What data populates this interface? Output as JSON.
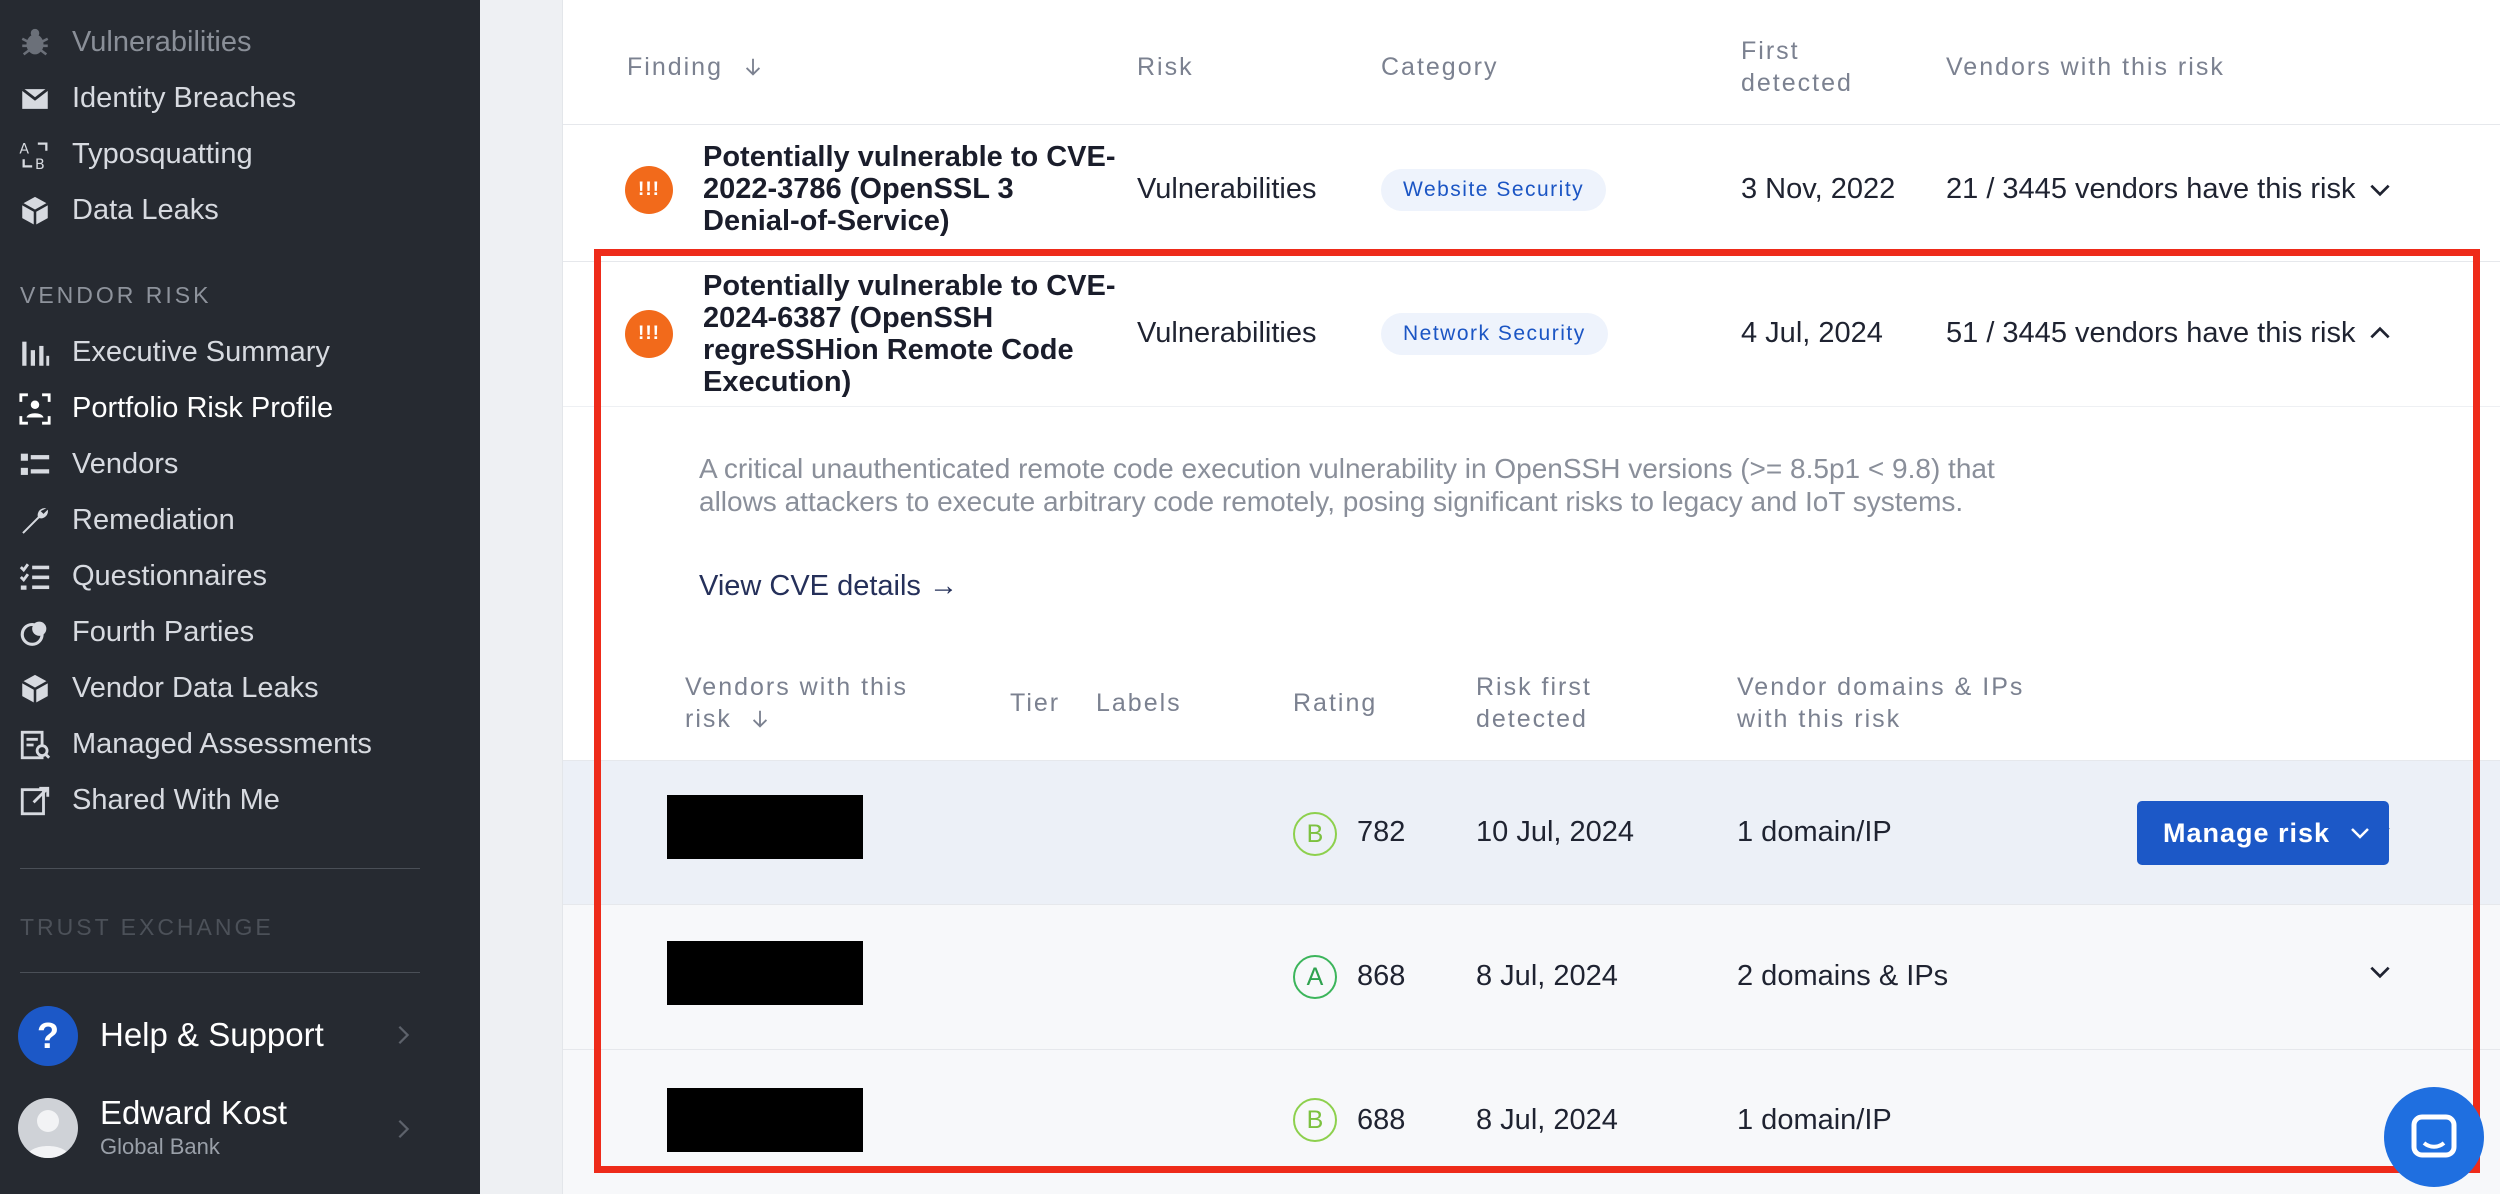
{
  "sidebar": {
    "items_top": [
      {
        "label": "Vulnerabilities",
        "icon": "bug-icon"
      },
      {
        "label": "Identity Breaches",
        "icon": "envelope-icon"
      },
      {
        "label": "Typosquatting",
        "icon": "typosquat-icon"
      },
      {
        "label": "Data Leaks",
        "icon": "cube-icon"
      }
    ],
    "vendor_risk_label": "VENDOR RISK",
    "vendor_items": [
      {
        "label": "Executive Summary",
        "icon": "bar-chart-icon"
      },
      {
        "label": "Portfolio Risk Profile",
        "icon": "portfolio-icon"
      },
      {
        "label": "Vendors",
        "icon": "list-icon"
      },
      {
        "label": "Remediation",
        "icon": "wrench-icon"
      },
      {
        "label": "Questionnaires",
        "icon": "checklist-icon"
      },
      {
        "label": "Fourth Parties",
        "icon": "fourth-parties-icon"
      },
      {
        "label": "Vendor Data Leaks",
        "icon": "cube-icon"
      },
      {
        "label": "Managed Assessments",
        "icon": "assessment-icon"
      },
      {
        "label": "Shared With Me",
        "icon": "share-icon"
      }
    ],
    "trust_exchange_label": "TRUST EXCHANGE",
    "help_label": "Help & Support",
    "user_name": "Edward Kost",
    "user_org": "Global Bank"
  },
  "table": {
    "headers": {
      "finding": "Finding",
      "risk": "Risk",
      "category": "Category",
      "first_detected_1": "First",
      "first_detected_2": "detected",
      "vendors": "Vendors with this risk"
    },
    "rows": [
      {
        "badge": "!!!",
        "title_lines": [
          "Potentially vulnerable to CVE-",
          "2022-3786 (OpenSSL 3",
          "Denial-of-Service)"
        ],
        "risk": "Vulnerabilities",
        "category": "Website Security",
        "first_detected": "3 Nov, 2022",
        "vendors": "21 / 3445 vendors have this risk"
      },
      {
        "badge": "!!!",
        "title_lines": [
          "Potentially vulnerable to CVE-",
          "2024-6387 (OpenSSH",
          "regreSSHion Remote Code",
          "Execution)"
        ],
        "risk": "Vulnerabilities",
        "category": "Network Security",
        "first_detected": "4 Jul, 2024",
        "vendors": "51 / 3445 vendors have this risk"
      }
    ]
  },
  "expanded": {
    "description_lines": [
      "A critical unauthenticated remote code execution vulnerability in OpenSSH versions (>= 8.5p1 < 9.8) that",
      "allows attackers to execute arbitrary code remotely, posing significant risks to legacy and IoT systems."
    ],
    "cve_link": "View CVE details →",
    "sub_headers": {
      "vendors_1": "Vendors with this",
      "vendors_2": "risk",
      "tier": "Tier",
      "labels": "Labels",
      "rating": "Rating",
      "risk_first_1": "Risk first",
      "risk_first_2": "detected",
      "domains_1": "Vendor domains & IPs",
      "domains_2": "with this risk"
    },
    "vendors": [
      {
        "grade": "B",
        "score": "782",
        "detected": "10 Jul, 2024",
        "domains": "1 domain/IP"
      },
      {
        "grade": "A",
        "score": "868",
        "detected": "8 Jul, 2024",
        "domains": "2 domains & IPs"
      },
      {
        "grade": "B",
        "score": "688",
        "detected": "8 Jul, 2024",
        "domains": "1 domain/IP"
      }
    ],
    "manage_button": "Manage risk"
  },
  "colors": {
    "highlight": "#ee2b1a",
    "accent": "#1c58c7",
    "risk_badge": "#f26a1b",
    "sidebar": "#262a31"
  }
}
